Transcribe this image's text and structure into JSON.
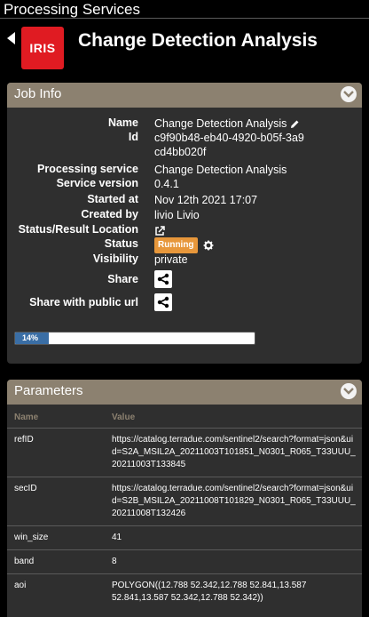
{
  "app": {
    "title": "Processing Services"
  },
  "service": {
    "logo_text": "IRIS",
    "title": "Change Detection Analysis"
  },
  "job_info": {
    "header": "Job Info",
    "fields": [
      {
        "label": "Name",
        "value": "Change Detection Analysis"
      },
      {
        "label": "Id",
        "value": "c9f90b48-eb40-4920-b05f-3a9cd4bb020f"
      },
      {
        "label": "Processing service",
        "value": "Change Detection Analysis"
      },
      {
        "label": "Service version",
        "value": "0.4.1"
      },
      {
        "label": "Started at",
        "value": "Nov 12th 2021 17:07"
      },
      {
        "label": "Created by",
        "value": "livio Livio"
      },
      {
        "label": "Status/Result Location",
        "value": ""
      },
      {
        "label": "Status",
        "value": "Running"
      },
      {
        "label": "Visibility",
        "value": "private"
      },
      {
        "label": "Share",
        "value": ""
      },
      {
        "label": "Share with public url",
        "value": ""
      }
    ],
    "progress": {
      "percent": 14,
      "label": "14%"
    }
  },
  "parameters": {
    "header": "Parameters",
    "columns": [
      "Name",
      "Value"
    ],
    "rows": [
      {
        "name": "refID",
        "value": "https://catalog.terradue.com/sentinel2/search?format=json&uid=S2A_MSIL2A_20211003T101851_N0301_R065_T33UUU_20211003T133845"
      },
      {
        "name": "secID",
        "value": "https://catalog.terradue.com/sentinel2/search?format=json&uid=S2B_MSIL2A_20211008T101829_N0301_R065_T33UUU_20211008T132426"
      },
      {
        "name": "win_size",
        "value": "41"
      },
      {
        "name": "band",
        "value": "8"
      },
      {
        "name": "aoi",
        "value": "POLYGON((12.788 52.342,12.788 52.841,13.587 52.841,13.587 52.342,12.788 52.342))"
      }
    ]
  },
  "colors": {
    "panel_header": "#8c8170",
    "logo": "#e01b22",
    "status_running": "#e7973b",
    "progress": "#3a6ea5"
  },
  "icons": {
    "back": "back-arrow-icon",
    "edit": "pencil-icon",
    "external": "external-link-icon",
    "settings": "gear-icon",
    "share": "share-icon",
    "collapse": "chevron-down-icon"
  }
}
